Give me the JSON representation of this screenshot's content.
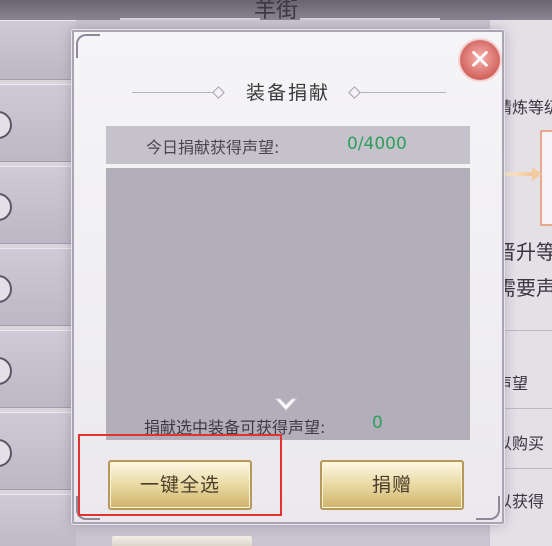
{
  "background": {
    "title": "羊街",
    "right_texts": [
      "精炼等级",
      "晋升等",
      "需要声",
      "声望",
      "以购买",
      "以获得"
    ]
  },
  "dialog": {
    "title": "装备捐献",
    "close_icon": "close-icon",
    "daily": {
      "label": "今日捐献获得声望:",
      "value": "0/4000"
    },
    "selected": {
      "label": "捐献选中装备可获得声望:",
      "value": "0"
    },
    "buttons": {
      "select_all": "一键全选",
      "donate": "捐赠"
    }
  },
  "colors": {
    "value_green": "#2f9e5c",
    "highlight_red": "#e0352f",
    "gold_button": "#e9d9a2"
  }
}
